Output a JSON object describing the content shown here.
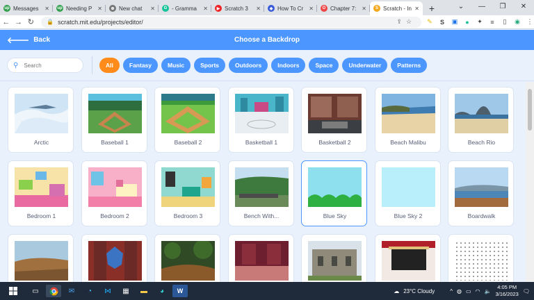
{
  "browser": {
    "tabs": [
      {
        "title": "Messages",
        "color": "#2e9e4a",
        "glyph": "up"
      },
      {
        "title": "Needing P",
        "color": "#2e9e4a",
        "glyph": "up"
      },
      {
        "title": "New chat",
        "color": "#777",
        "glyph": "⊛"
      },
      {
        "title": "- Gramma",
        "color": "#15c39a",
        "glyph": "G"
      },
      {
        "title": "Scratch 3",
        "color": "#e22",
        "glyph": "▶"
      },
      {
        "title": "How To Cr",
        "color": "#3a5bd9",
        "glyph": "◆"
      },
      {
        "title": "Chapter 7:",
        "color": "#e44",
        "glyph": "O"
      },
      {
        "title": "Scratch - In",
        "color": "#f4a81d",
        "glyph": "S"
      }
    ],
    "url": "scratch.mit.edu/projects/editor/",
    "new_tab_label": "+"
  },
  "header": {
    "back_label": "Back",
    "title": "Choose a Backdrop"
  },
  "filter": {
    "search_placeholder": "Search",
    "categories": [
      "All",
      "Fantasy",
      "Music",
      "Sports",
      "Outdoors",
      "Indoors",
      "Space",
      "Underwater",
      "Patterns"
    ],
    "active": "All"
  },
  "backdrops": [
    {
      "name": "Arctic"
    },
    {
      "name": "Baseball 1"
    },
    {
      "name": "Baseball 2"
    },
    {
      "name": "Basketball 1"
    },
    {
      "name": "Basketball 2"
    },
    {
      "name": "Beach Malibu"
    },
    {
      "name": "Beach Rio"
    },
    {
      "name": "Bedroom 1"
    },
    {
      "name": "Bedroom 2"
    },
    {
      "name": "Bedroom 3"
    },
    {
      "name": "Bench With..."
    },
    {
      "name": "Blue Sky",
      "selected": true
    },
    {
      "name": "Blue Sky 2"
    },
    {
      "name": "Boardwalk"
    },
    {
      "name": ""
    },
    {
      "name": ""
    },
    {
      "name": ""
    },
    {
      "name": ""
    },
    {
      "name": ""
    },
    {
      "name": ""
    },
    {
      "name": ""
    }
  ],
  "taskbar": {
    "weather": "23°C  Cloudy",
    "time": "4:05 PM",
    "date": "3/16/2023"
  }
}
